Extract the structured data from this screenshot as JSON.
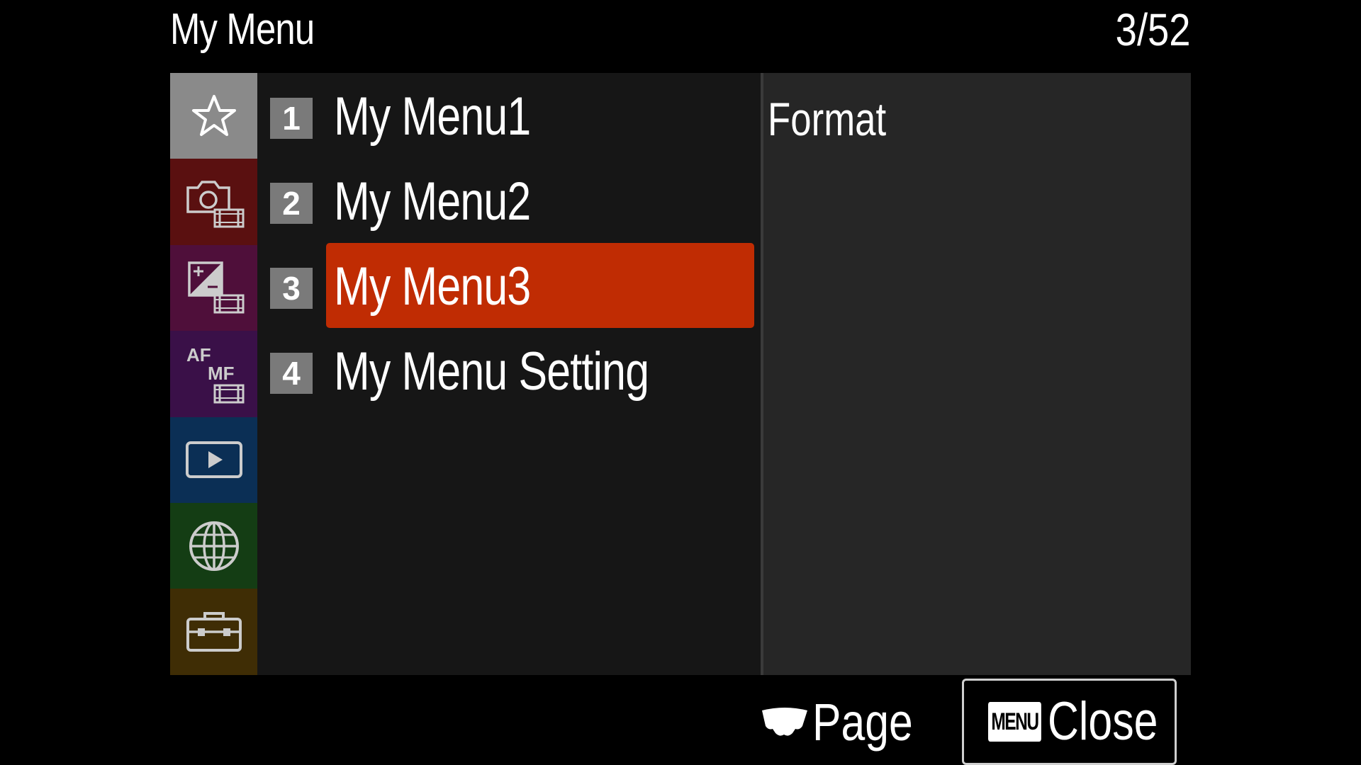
{
  "header": {
    "title": "My Menu",
    "page_indicator": "3/52"
  },
  "sidebar": {
    "items": [
      {
        "icon": "star-icon",
        "color": "#8a8a8a",
        "selected": true
      },
      {
        "icon": "camera-movie-icon",
        "color": "#5a1010"
      },
      {
        "icon": "exposure-movie-icon",
        "color": "#4f0f3a"
      },
      {
        "icon": "af-mf-movie-icon",
        "color": "#3a1048",
        "af_text": "AF",
        "mf_text": "MF"
      },
      {
        "icon": "playback-icon",
        "color": "#0b2f55"
      },
      {
        "icon": "network-globe-icon",
        "color": "#143d14"
      },
      {
        "icon": "toolbox-icon",
        "color": "#3f2d05"
      }
    ]
  },
  "menu": {
    "items": [
      {
        "number": "1",
        "label": "My Menu1",
        "selected": false
      },
      {
        "number": "2",
        "label": "My Menu2",
        "selected": false
      },
      {
        "number": "3",
        "label": "My Menu3",
        "selected": true
      },
      {
        "number": "4",
        "label": "My Menu Setting",
        "selected": false
      }
    ],
    "selected_color": "#c02c03"
  },
  "detail": {
    "items": [
      "Format"
    ]
  },
  "footer": {
    "page_label": "Page",
    "menu_badge": "MENU",
    "close_label": "Close"
  }
}
